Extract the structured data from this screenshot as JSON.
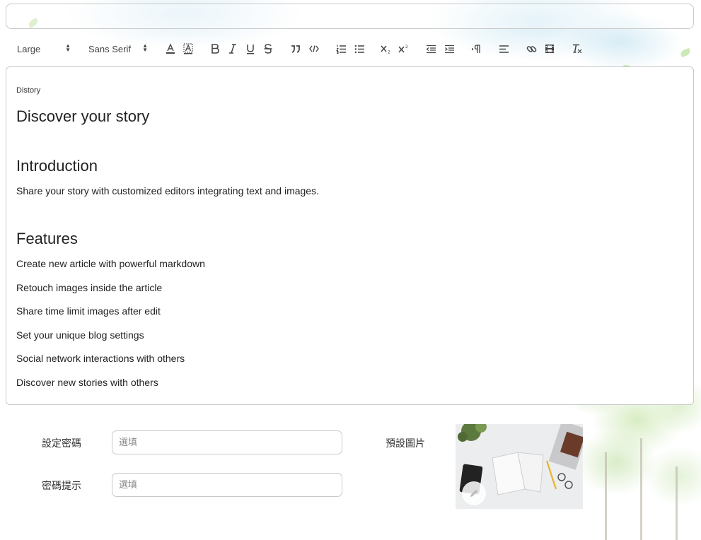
{
  "toolbar": {
    "size_select": "Large",
    "font_select": "Sans Serif",
    "buttons": [
      "font-color",
      "background-color",
      "bold",
      "italic",
      "underline",
      "strike",
      "blockquote",
      "code-block",
      "ordered-list",
      "bullet-list",
      "subscript",
      "superscript",
      "outdent",
      "indent",
      "text-direction",
      "align",
      "link",
      "video",
      "clean"
    ]
  },
  "editor": {
    "small_label": "Distory",
    "title": "Discover your story",
    "intro_heading": "Introduction",
    "intro_text": "Share your story with customized editors integrating text and images.",
    "features_heading": "Features",
    "features": [
      "Create new article with powerful markdown",
      "Retouch images inside the article",
      "Share time limit images after edit",
      "Set your unique blog settings",
      "Social network interactions with others",
      "Discover new stories with others"
    ]
  },
  "form": {
    "password_label": "設定密碼",
    "password_placeholder": "選填",
    "hint_label": "密碼提示",
    "hint_placeholder": "選填",
    "default_image_label": "預設圖片"
  },
  "colors": {
    "border": "#c9c9c9",
    "text": "#222222",
    "toolbar_icon": "#444444"
  }
}
